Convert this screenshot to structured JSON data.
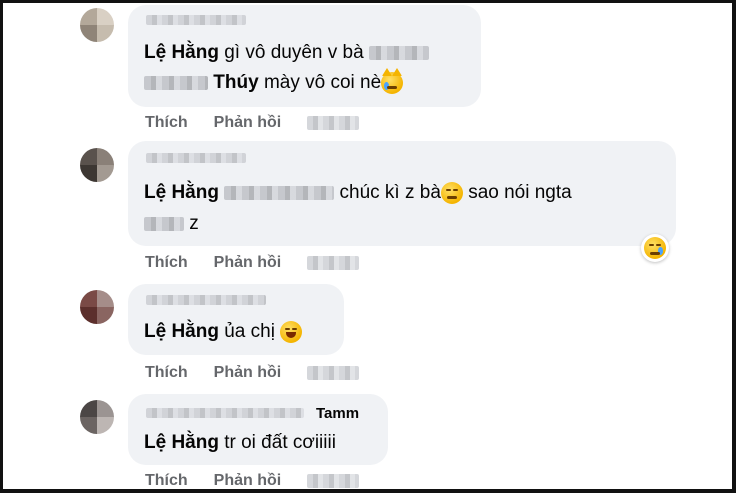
{
  "comments": [
    {
      "line1_name": "Lệ Hằng",
      "line1_text": "gì vô duyên v bà",
      "line2_name": "Thúy",
      "line2_text": "mày vô coi nè",
      "emoji": "crying-cat-emoji",
      "actions": {
        "like": "Thích",
        "reply": "Phản hồi"
      }
    },
    {
      "line1_name": "Lệ Hằng",
      "line1_text": "chúc kì z bà",
      "line1_emoji": "pensive-face-emoji",
      "line1_text2": "sao nói ngta",
      "line2_text": "z",
      "reaction": "sad-reaction-icon",
      "actions": {
        "like": "Thích",
        "reply": "Phản hồi"
      }
    },
    {
      "line1_name": "Lệ Hằng",
      "line1_text": "ủa chị",
      "emoji": "laughing-face-emoji",
      "actions": {
        "like": "Thích",
        "reply": "Phản hồi"
      }
    },
    {
      "author_suffix": "Tamm",
      "line1_name": "Lệ Hằng",
      "line1_text": "tr oi đất cơiiiii",
      "actions": {
        "like": "Thích",
        "reply": "Phản hồi"
      }
    }
  ],
  "colors": {
    "bubble": "#f0f2f5",
    "action_text": "#65676b",
    "text": "#050505"
  }
}
